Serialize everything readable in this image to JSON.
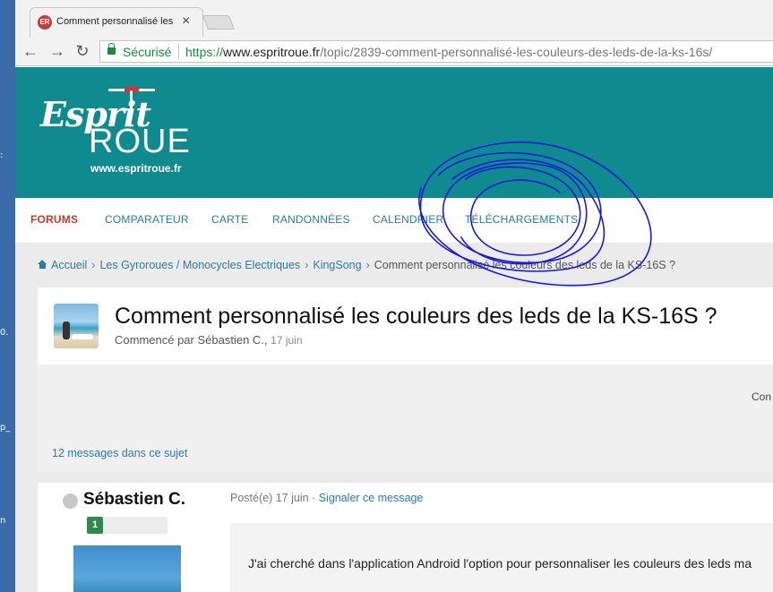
{
  "desktop": {
    "fragments": [
      ":",
      "0.",
      "p_",
      "n"
    ]
  },
  "browser": {
    "tab_title": "Comment personnalisé les c",
    "tab_close": "×",
    "favicon_text": "ER",
    "nav_back": "←",
    "nav_forward": "→",
    "nav_reload": "↻",
    "secure_label": "Sécurisé",
    "url_scheme": "https://",
    "url_host": "www.espritroue.fr",
    "url_path": "/topic/2839-comment-personnalisé-les-couleurs-des-leds-de-la-ks-16s/"
  },
  "site": {
    "logo_esprit": "Esprit",
    "logo_roue": "ROUE",
    "logo_url": "www.espritroue.fr",
    "nav": [
      {
        "label": "FORUMS",
        "active": true
      },
      {
        "label": "COMPARATEUR",
        "active": false
      },
      {
        "label": "CARTE",
        "active": false
      },
      {
        "label": "RANDONNÉES",
        "active": false
      },
      {
        "label": "CALENDRIER",
        "active": false
      },
      {
        "label": "TÉLÉCHARGEMENTS",
        "active": false
      }
    ],
    "breadcrumb": [
      "Accueil",
      "Les Gyroroues / Monocycles Electriques",
      "KingSong",
      "Comment personnalisé les couleurs des leds de la KS-16S ?"
    ]
  },
  "topic": {
    "title": "Comment personnalisé les couleurs des leds de la KS-16S ?",
    "started_prefix": "Commencé par Sébastien C.,",
    "started_date": "17 juin",
    "actions_clip": "Con",
    "message_count": "12 messages dans ce sujet"
  },
  "post": {
    "author": "Sébastien C.",
    "reputation": "1",
    "meta_posted": "Posté(e) 17 juin",
    "meta_sep": "·",
    "report_link": "Signaler ce message",
    "body_text": "J'ai cherché dans l'application Android l'option pour personnaliser les couleurs des leds ma"
  },
  "colors": {
    "header_teal": "#0f8a8f",
    "nav_active": "#c9382f",
    "link_blue": "#2b7aa8",
    "scribble": "#1a1adc"
  }
}
